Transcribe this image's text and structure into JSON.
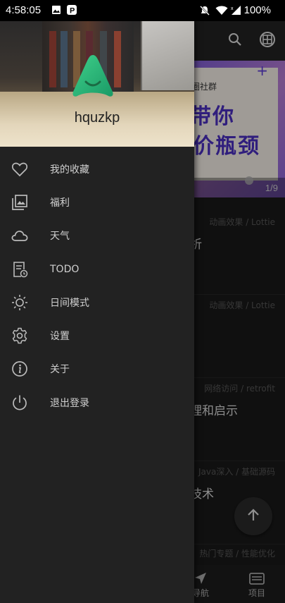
{
  "status_bar": {
    "time": "4:58:05",
    "battery": "100%"
  },
  "toolbar": {
    "search_icon": "search-icon",
    "browser_icon": "globe-icon"
  },
  "banner": {
    "line1": "圈社群",
    "line2": "带你",
    "line3": "价瓶颈",
    "counter": "1/9"
  },
  "articles": [
    {
      "category": "动画效果 / Lottie",
      "title": "析"
    },
    {
      "category": "动画效果 / Lottie",
      "title": ""
    },
    {
      "category": "网络访问 / retrofit",
      "title": "理和启示"
    },
    {
      "category": "Java深入 / 基础源码",
      "title": "技术"
    },
    {
      "category": "热门专题 / 性能优化",
      "title": ""
    }
  ],
  "bottom_nav": {
    "nav_label": "导航",
    "project_label": "项目"
  },
  "drawer": {
    "username": "hquzkp",
    "menu": [
      {
        "label": "我的收藏",
        "icon": "heart-icon"
      },
      {
        "label": "福利",
        "icon": "photo-library-icon"
      },
      {
        "label": "天气",
        "icon": "cloud-icon"
      },
      {
        "label": "TODO",
        "icon": "todo-list-icon"
      },
      {
        "label": "日间模式",
        "icon": "sun-icon"
      },
      {
        "label": "设置",
        "icon": "gear-icon"
      },
      {
        "label": "关于",
        "icon": "info-icon"
      },
      {
        "label": "退出登录",
        "icon": "power-icon"
      }
    ]
  },
  "colors": {
    "drawer_bg": "#222222",
    "accent_green": "#2ec47a",
    "banner_purple": "#4a2ec0"
  }
}
